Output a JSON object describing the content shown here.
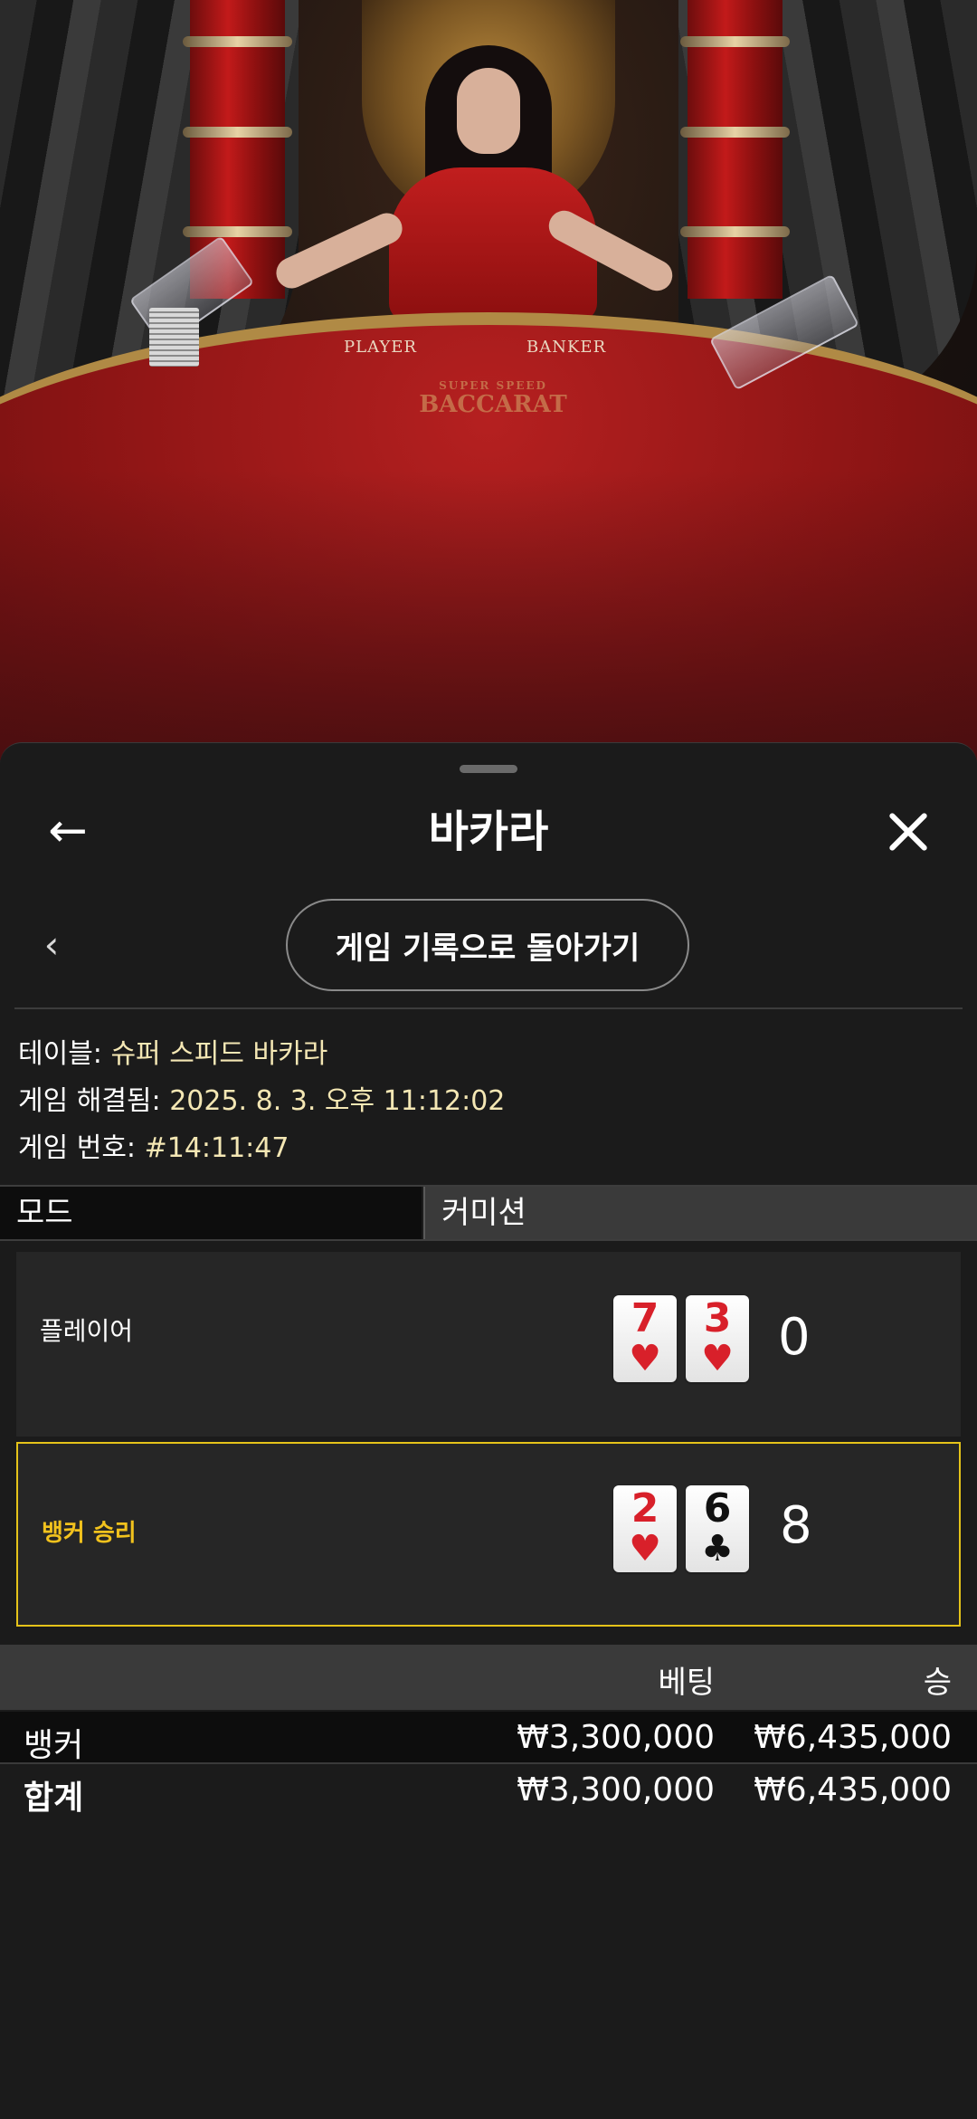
{
  "scene": {
    "table_labels": {
      "player": "PLAYER",
      "banker": "BANKER"
    },
    "logo_small": "SUPER SPEED",
    "logo_big": "BACCARAT"
  },
  "header": {
    "title": "바카라",
    "back_icon": "arrow-left-icon",
    "close_icon": "close-icon"
  },
  "nav": {
    "history_button": "게임 기록으로 돌아가기"
  },
  "info": {
    "table_label": "테이블: ",
    "table_value": "슈퍼 스피드 바카라",
    "resolved_label": "게임 해결됨: ",
    "resolved_value": "2025. 8. 3. 오후 11:12:02",
    "number_label": "게임 번호: ",
    "number_value": "#14:11:47"
  },
  "tabs": {
    "mode": "모드",
    "commission": "커미션"
  },
  "result": {
    "player": {
      "label": "플레이어",
      "cards": [
        {
          "rank": "7",
          "suit": "♥"
        },
        {
          "rank": "3",
          "suit": "♥"
        }
      ],
      "score": "0"
    },
    "banker": {
      "label": "뱅커 승리",
      "cards": [
        {
          "rank": "2",
          "suit": "♥"
        },
        {
          "rank": "6",
          "suit": "♣"
        }
      ],
      "score": "8"
    },
    "highlight_color": "#e5c319"
  },
  "bets": {
    "headers": {
      "bet": "베팅",
      "win": "승"
    },
    "rows": [
      {
        "name": "뱅커",
        "bet": "₩3,300,000",
        "win": "₩6,435,000"
      },
      {
        "name": "합계",
        "bet": "₩3,300,000",
        "win": "₩6,435,000"
      }
    ]
  }
}
